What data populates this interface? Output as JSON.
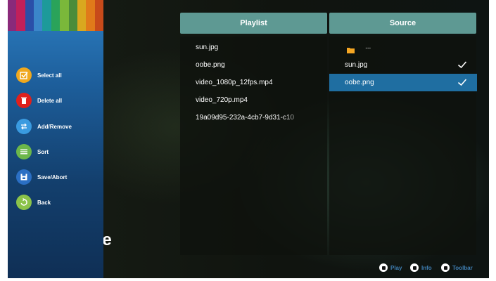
{
  "background_text": "se",
  "drawer": {
    "items": [
      {
        "label": "Select all",
        "icon": "checkbox-icon",
        "color": "#f0a81d"
      },
      {
        "label": "Delete all",
        "icon": "trash-icon",
        "color": "#e0201c"
      },
      {
        "label": "Add/Remove",
        "icon": "swap-icon",
        "color": "#3a9be0"
      },
      {
        "label": "Sort",
        "icon": "list-icon",
        "color": "#6cb74a"
      },
      {
        "label": "Save/Abort",
        "icon": "floppy-icon",
        "color": "#2b6fc4"
      },
      {
        "label": "Back",
        "icon": "back-icon",
        "color": "#8bc34a"
      }
    ]
  },
  "playlist": {
    "header": "Playlist",
    "items": [
      "sun.jpg",
      "oobe.png",
      "video_1080p_12fps.mp4",
      "video_720p.mp4",
      "19a09d95-232a-4cb7-9d31-c10"
    ]
  },
  "source": {
    "header": "Source",
    "folder_label": "...",
    "items": [
      {
        "label": "sun.jpg",
        "checked": true,
        "selected": false
      },
      {
        "label": "oobe.png",
        "checked": true,
        "selected": true
      }
    ]
  },
  "hints": [
    {
      "label": "Play",
      "icon": "play-key-icon"
    },
    {
      "label": "Info",
      "icon": "info-key-icon"
    },
    {
      "label": "Toolbar",
      "icon": "toolbar-key-icon"
    }
  ],
  "colors": {
    "header": "#5e9993",
    "selected_row": "#1f6ea1",
    "hint_text": "#3f7fb4"
  }
}
